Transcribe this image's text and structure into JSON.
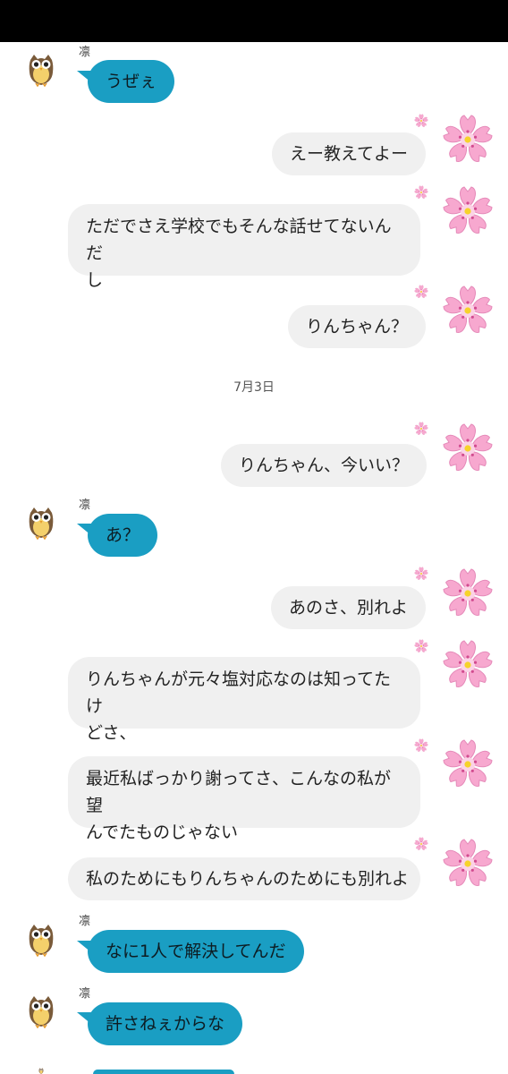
{
  "status_bar": {},
  "date_separator": "7月3日",
  "messages": [
    {
      "sender": "凛",
      "text": "うぜぇ"
    },
    {
      "text": "えー教えてよー"
    },
    {
      "text_line1": "ただでさえ学校でもそんな話せてないんだ",
      "text_line2": "し"
    },
    {
      "text": "りんちゃん？"
    },
    {
      "text": "りんちゃん、今いい？"
    },
    {
      "sender": "凛",
      "text": "あ？"
    },
    {
      "text": "あのさ、別れよ"
    },
    {
      "text_line1": "りんちゃんが元々塩対応なのは知ってたけ",
      "text_line2": "どさ、"
    },
    {
      "text_line1": "最近私ばっかり謝ってさ、こんなの私が望",
      "text_line2": "んでたものじゃない"
    },
    {
      "text": "私のためにもりんちゃんのためにも別れよ"
    },
    {
      "sender": "凛",
      "text": "なに1人で解決してんだ"
    },
    {
      "sender": "凛",
      "text": "許さねぇからな"
    }
  ],
  "colors": {
    "incoming_bubble": "#1a9ec3",
    "outgoing_bubble": "#f0f0f0",
    "top_bar": "#000000"
  },
  "icons": {
    "incoming_avatar": "owl-icon",
    "outgoing_avatar": "cherry-blossom-icon"
  }
}
